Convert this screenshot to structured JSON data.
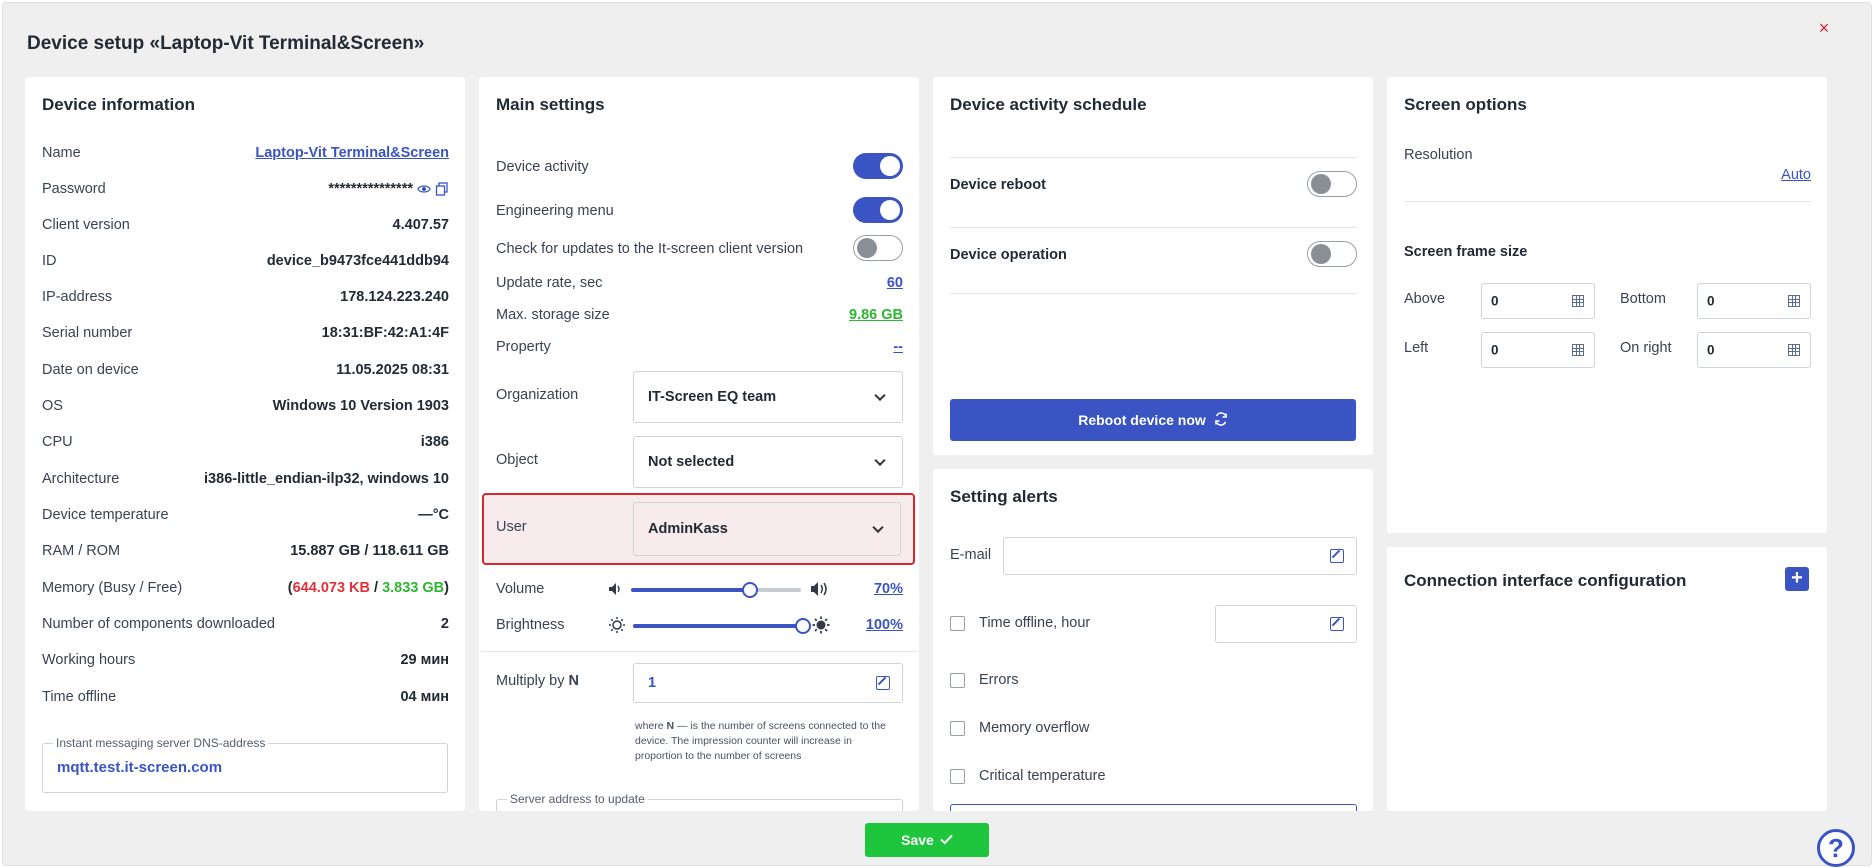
{
  "modal": {
    "title": "Device setup «Laptop-Vit Terminal&Screen»",
    "close_label": "×"
  },
  "device_info": {
    "title": "Device information",
    "rows": [
      {
        "key": "Name",
        "value": "Laptop-Vit Terminal&Screen"
      },
      {
        "key": "Password",
        "value": "***************"
      },
      {
        "key": "Client version",
        "value": "4.407.57"
      },
      {
        "key": "ID",
        "value": "device_b9473fce441ddb94"
      },
      {
        "key": "IP-address",
        "value": "178.124.223.240"
      },
      {
        "key": "Serial number",
        "value": "18:31:BF:42:A1:4F"
      },
      {
        "key": "Date on device",
        "value": "11.05.2025 08:31"
      },
      {
        "key": "OS",
        "value": "Windows 10 Version 1903"
      },
      {
        "key": "CPU",
        "value": "i386"
      },
      {
        "key": "Architecture",
        "value": "i386-little_endian-ilp32, windows 10"
      },
      {
        "key": "Device temperature",
        "value": "—°C"
      },
      {
        "key": "RAM / ROM",
        "value": "15.887 GB / 118.611 GB"
      },
      {
        "key": "Memory (Busy / Free)",
        "value_open": "(",
        "busy": "644.073 KB",
        "sep": " / ",
        "free": "3.833 GB",
        "value_close": ")"
      },
      {
        "key": "Number of components downloaded",
        "value": "2"
      },
      {
        "key": "Working hours",
        "value": "29 мин"
      },
      {
        "key": "Time offline",
        "value": "04 мин"
      }
    ],
    "dns": {
      "legend": "Instant messaging server DNS-address",
      "value": "mqtt.test.it-screen.com"
    }
  },
  "main_settings": {
    "title": "Main settings",
    "device_activity": {
      "label": "Device activity",
      "on": true
    },
    "engineering_menu": {
      "label": "Engineering menu",
      "on": true
    },
    "check_updates": {
      "label": "Check for updates to the It-screen client version",
      "on": false
    },
    "update_rate": {
      "label": "Update rate, sec",
      "value": "60"
    },
    "max_storage": {
      "label": "Max. storage size",
      "value": "9.86 GB"
    },
    "property": {
      "label": "Property",
      "value": "--"
    },
    "organization": {
      "label": "Organization",
      "value": "IT-Screen EQ team"
    },
    "object": {
      "label": "Object",
      "value": "Not selected"
    },
    "user": {
      "label": "User",
      "value": "AdminKass"
    },
    "volume": {
      "label": "Volume",
      "value": "70%",
      "level": 0.7
    },
    "brightness": {
      "label": "Brightness",
      "value": "100%",
      "level": 1.0
    },
    "multiply": {
      "label_prefix": "Multiply by ",
      "label_n": "N",
      "value": "1"
    },
    "note": {
      "prefix": "where ",
      "n": "N",
      "rest": " — is the number of screens connected to the device. The impression counter will increase in proportion to the number of screens"
    },
    "server_address": {
      "legend": "Server address to update"
    }
  },
  "schedule": {
    "title": "Device activity schedule",
    "reboot": {
      "label": "Device reboot",
      "on": false
    },
    "operation": {
      "label": "Device operation",
      "on": false
    },
    "reboot_now_label": "Reboot device now"
  },
  "alerts": {
    "title": "Setting alerts",
    "email_label": "E-mail",
    "email_value": "",
    "time_offline_label": "Time offline, hour",
    "errors_label": "Errors",
    "memory_overflow_label": "Memory overflow",
    "critical_temp_label": "Critical temperature"
  },
  "screen_options": {
    "title": "Screen options",
    "resolution_label": "Resolution",
    "resolution_value": "Auto",
    "frame_title": "Screen frame size",
    "above": {
      "label": "Above",
      "value": "0"
    },
    "bottom": {
      "label": "Bottom",
      "value": "0"
    },
    "left": {
      "label": "Left",
      "value": "0"
    },
    "right": {
      "label": "On right",
      "value": "0"
    }
  },
  "connection": {
    "title": "Connection interface configuration",
    "add_label": "+"
  },
  "footer": {
    "save_label": "Save",
    "help_label": "?"
  },
  "colors": {
    "accent": "#3a54c4",
    "success": "#1ec63e",
    "danger": "#d9262e"
  }
}
